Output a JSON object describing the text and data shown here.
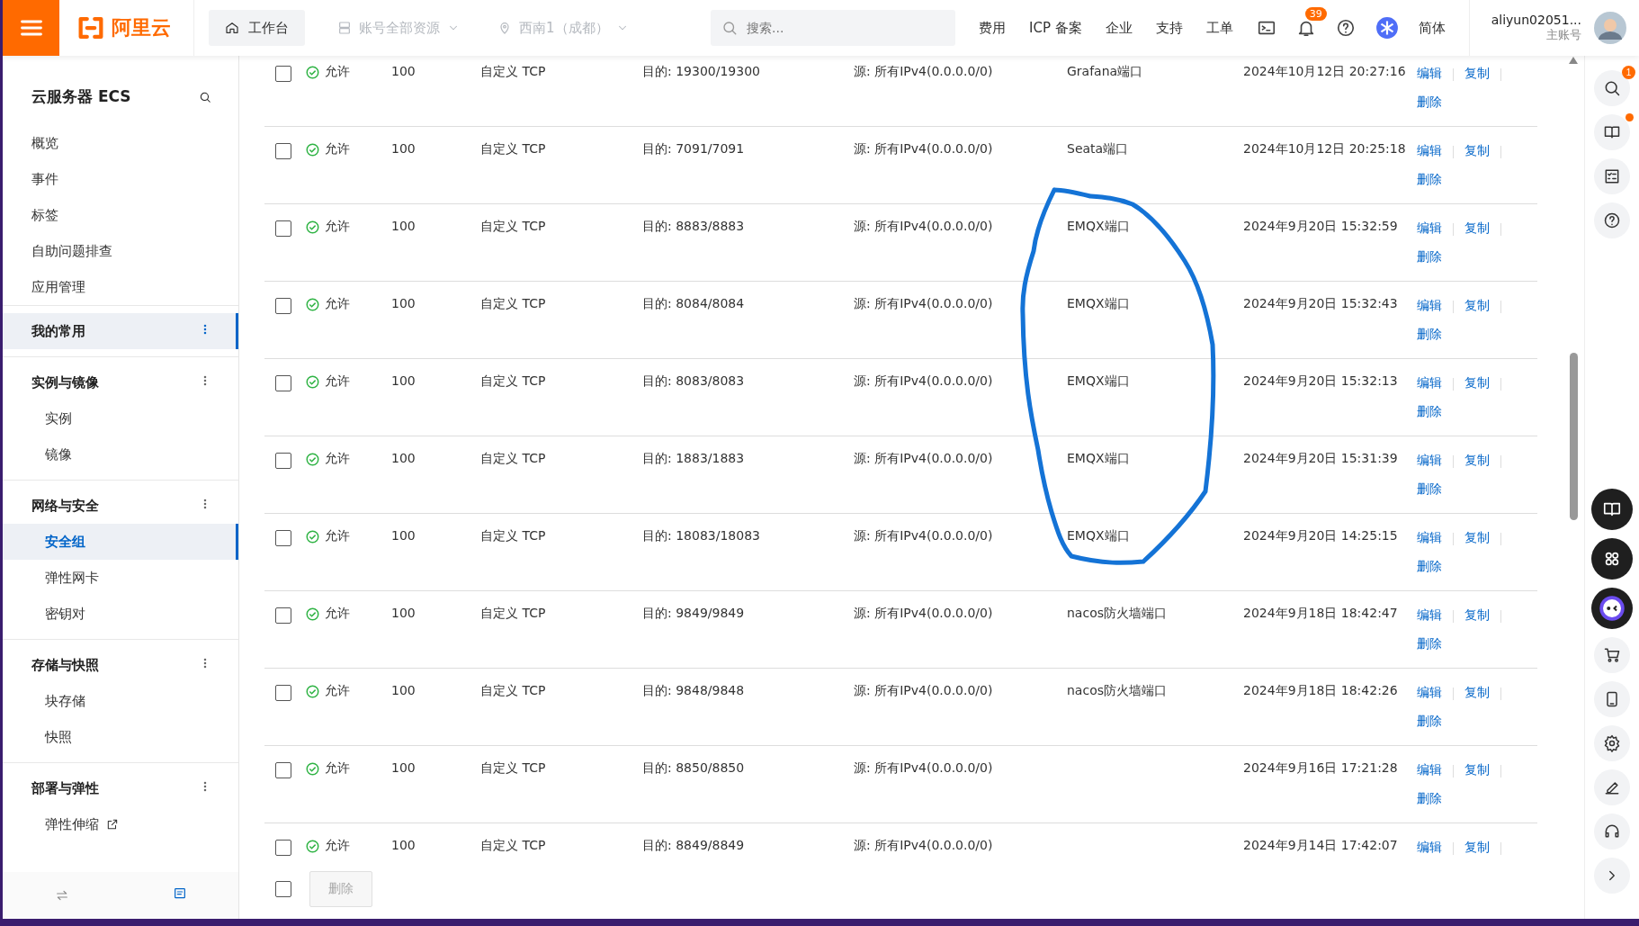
{
  "topbar": {
    "logo_text": "阿里云",
    "workbench": "工作台",
    "account_scope": "账号全部资源",
    "region": "西南1（成都）",
    "search_placeholder": "搜索...",
    "links": [
      "费用",
      "ICP 备案",
      "企业",
      "支持",
      "工单"
    ],
    "notification_count": "39",
    "language": "简体",
    "username": "aliyun02051...",
    "account_type": "主账号"
  },
  "sidebar": {
    "title": "云服务器 ECS",
    "sections": [
      {
        "kind": "plain",
        "items": [
          {
            "label": "概览",
            "selected": false,
            "external": false
          },
          {
            "label": "事件",
            "selected": false,
            "external": false
          },
          {
            "label": "标签",
            "selected": false,
            "external": false
          },
          {
            "label": "自助问题排查",
            "selected": false,
            "external": false
          },
          {
            "label": "应用管理",
            "selected": false,
            "external": false
          }
        ]
      },
      {
        "kind": "group",
        "title": "我的常用",
        "selected": true
      },
      {
        "kind": "group",
        "title": "实例与镜像",
        "selected": false,
        "items": [
          {
            "label": "实例",
            "selected": false,
            "external": false
          },
          {
            "label": "镜像",
            "selected": false,
            "external": false
          }
        ]
      },
      {
        "kind": "group",
        "title": "网络与安全",
        "selected": false,
        "items": [
          {
            "label": "安全组",
            "selected": true,
            "external": false
          },
          {
            "label": "弹性网卡",
            "selected": false,
            "external": false
          },
          {
            "label": "密钥对",
            "selected": false,
            "external": false
          }
        ]
      },
      {
        "kind": "group",
        "title": "存储与快照",
        "selected": false,
        "items": [
          {
            "label": "块存储",
            "selected": false,
            "external": false
          },
          {
            "label": "快照",
            "selected": false,
            "external": false
          }
        ]
      },
      {
        "kind": "group",
        "title": "部署与弹性",
        "selected": false,
        "items": [
          {
            "label": "弹性伸缩",
            "selected": false,
            "external": true
          }
        ]
      }
    ]
  },
  "table": {
    "rows": [
      {
        "checked": false,
        "policy": "允许",
        "priority": "100",
        "protocol": "自定义 TCP",
        "port": "目的: 19300/19300",
        "source": "源: 所有IPv4(0.0.0.0/0)",
        "description": "Grafana端口",
        "created": "2024年10月12日 20:27:16",
        "actions": [
          "编辑",
          "复制",
          "删除"
        ]
      },
      {
        "checked": false,
        "policy": "允许",
        "priority": "100",
        "protocol": "自定义 TCP",
        "port": "目的: 7091/7091",
        "source": "源: 所有IPv4(0.0.0.0/0)",
        "description": "Seata端口",
        "created": "2024年10月12日 20:25:18",
        "actions": [
          "编辑",
          "复制",
          "删除"
        ]
      },
      {
        "checked": false,
        "policy": "允许",
        "priority": "100",
        "protocol": "自定义 TCP",
        "port": "目的: 8883/8883",
        "source": "源: 所有IPv4(0.0.0.0/0)",
        "description": "EMQX端口",
        "created": "2024年9月20日 15:32:59",
        "actions": [
          "编辑",
          "复制",
          "删除"
        ]
      },
      {
        "checked": false,
        "policy": "允许",
        "priority": "100",
        "protocol": "自定义 TCP",
        "port": "目的: 8084/8084",
        "source": "源: 所有IPv4(0.0.0.0/0)",
        "description": "EMQX端口",
        "created": "2024年9月20日 15:32:43",
        "actions": [
          "编辑",
          "复制",
          "删除"
        ]
      },
      {
        "checked": false,
        "policy": "允许",
        "priority": "100",
        "protocol": "自定义 TCP",
        "port": "目的: 8083/8083",
        "source": "源: 所有IPv4(0.0.0.0/0)",
        "description": "EMQX端口",
        "created": "2024年9月20日 15:32:13",
        "actions": [
          "编辑",
          "复制",
          "删除"
        ]
      },
      {
        "checked": false,
        "policy": "允许",
        "priority": "100",
        "protocol": "自定义 TCP",
        "port": "目的: 1883/1883",
        "source": "源: 所有IPv4(0.0.0.0/0)",
        "description": "EMQX端口",
        "created": "2024年9月20日 15:31:39",
        "actions": [
          "编辑",
          "复制",
          "删除"
        ]
      },
      {
        "checked": false,
        "policy": "允许",
        "priority": "100",
        "protocol": "自定义 TCP",
        "port": "目的: 18083/18083",
        "source": "源: 所有IPv4(0.0.0.0/0)",
        "description": "EMQX端口",
        "created": "2024年9月20日 14:25:15",
        "actions": [
          "编辑",
          "复制",
          "删除"
        ]
      },
      {
        "checked": false,
        "policy": "允许",
        "priority": "100",
        "protocol": "自定义 TCP",
        "port": "目的: 9849/9849",
        "source": "源: 所有IPv4(0.0.0.0/0)",
        "description": "nacos防火墙端口",
        "created": "2024年9月18日 18:42:47",
        "actions": [
          "编辑",
          "复制",
          "删除"
        ]
      },
      {
        "checked": false,
        "policy": "允许",
        "priority": "100",
        "protocol": "自定义 TCP",
        "port": "目的: 9848/9848",
        "source": "源: 所有IPv4(0.0.0.0/0)",
        "description": "nacos防火墙端口",
        "created": "2024年9月18日 18:42:26",
        "actions": [
          "编辑",
          "复制",
          "删除"
        ]
      },
      {
        "checked": false,
        "policy": "允许",
        "priority": "100",
        "protocol": "自定义 TCP",
        "port": "目的: 8850/8850",
        "source": "源: 所有IPv4(0.0.0.0/0)",
        "created": "2024年9月16日 17:21:28",
        "actions": [
          "编辑",
          "复制",
          "删除"
        ]
      },
      {
        "checked": false,
        "policy": "允许",
        "priority": "100",
        "protocol": "自定义 TCP",
        "port": "目的: 8849/8849",
        "source": "源: 所有IPv4(0.0.0.0/0)",
        "created": "2024年9月14日 17:42:07",
        "actions": [
          "编辑",
          "复制"
        ]
      }
    ]
  },
  "footer": {
    "select_all_checked": false,
    "delete_label": "删除",
    "delete_disabled": true
  },
  "rail": {
    "search_badge": "1"
  }
}
